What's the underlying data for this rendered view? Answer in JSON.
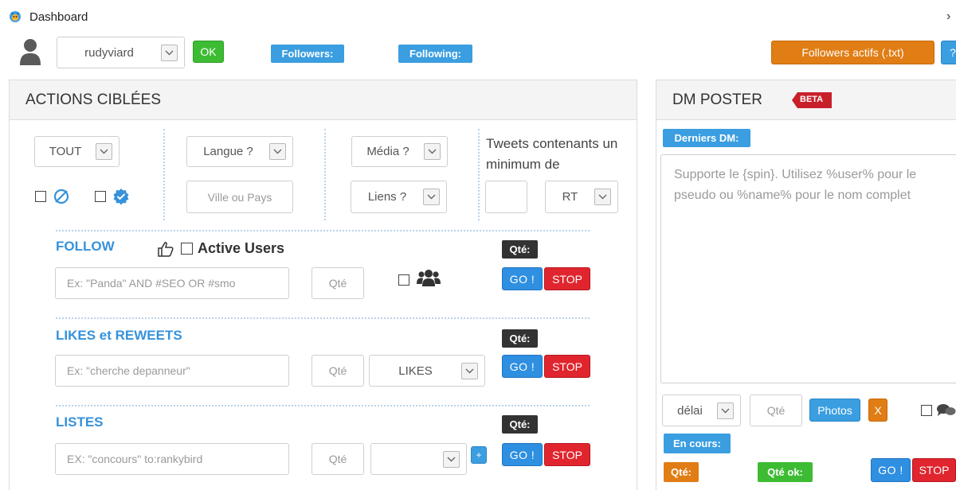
{
  "window": {
    "title": "Dashboard"
  },
  "topbar": {
    "account_select": "rudyviard",
    "ok_label": "OK",
    "followers_label": "Followers:",
    "following_label": "Following:",
    "export_button": "Followers actifs (.txt)",
    "help_button": "?"
  },
  "actions": {
    "title": "ACTIONS CIBLÉES",
    "filters": {
      "scope_select": "TOUT",
      "language_select": "Langue ?",
      "location_placeholder": "Ville ou Pays",
      "media_select": "Média ?",
      "links_select": "Liens ?",
      "tweets_min_label": "Tweets contenants un minimum de",
      "rt_select": "RT"
    },
    "follow": {
      "title": "FOLLOW",
      "active_users_label": "Active Users",
      "query_placeholder": "Ex: \"Panda\" AND #SEO OR #smo",
      "qty_placeholder": "Qté",
      "qty_badge": "Qté:",
      "go_label": "GO !",
      "stop_label": "STOP"
    },
    "likes": {
      "title": "LIKES et REWEETS",
      "query_placeholder": "Ex: \"cherche depanneur\"",
      "qty_placeholder": "Qté",
      "mode_select": "LIKES",
      "qty_badge": "Qté:",
      "go_label": "GO !",
      "stop_label": "STOP"
    },
    "lists": {
      "title": "LISTES",
      "query_placeholder": "EX: \"concours\" to:rankybird",
      "qty_placeholder": "Qté",
      "list_select": "",
      "add_button": "+",
      "qty_badge": "Qté:",
      "go_label": "GO !",
      "stop_label": "STOP"
    }
  },
  "dm_poster": {
    "title": "DM POSTER",
    "beta_badge": "BETA",
    "last_dm_label": "Derniers DM:",
    "message_placeholder": "Supporte le {spin}. Utilisez %user% pour le pseudo ou %name% pour le nom complet",
    "delay_select": "délai",
    "qty_placeholder": "Qté",
    "photos_button": "Photos",
    "remove_photo_button": "X",
    "in_progress_label": "En cours:",
    "qty_badge": "Qté:",
    "qty_ok_badge": "Qté ok:",
    "go_label": "GO !",
    "stop_label": "STOP"
  },
  "colors": {
    "accent_blue": "#3a9ee0",
    "go_blue": "#2f8fe0",
    "stop_red": "#e0252e",
    "ok_green": "#3dbc33",
    "export_orange": "#e07d14",
    "beta_red": "#c8202a"
  }
}
